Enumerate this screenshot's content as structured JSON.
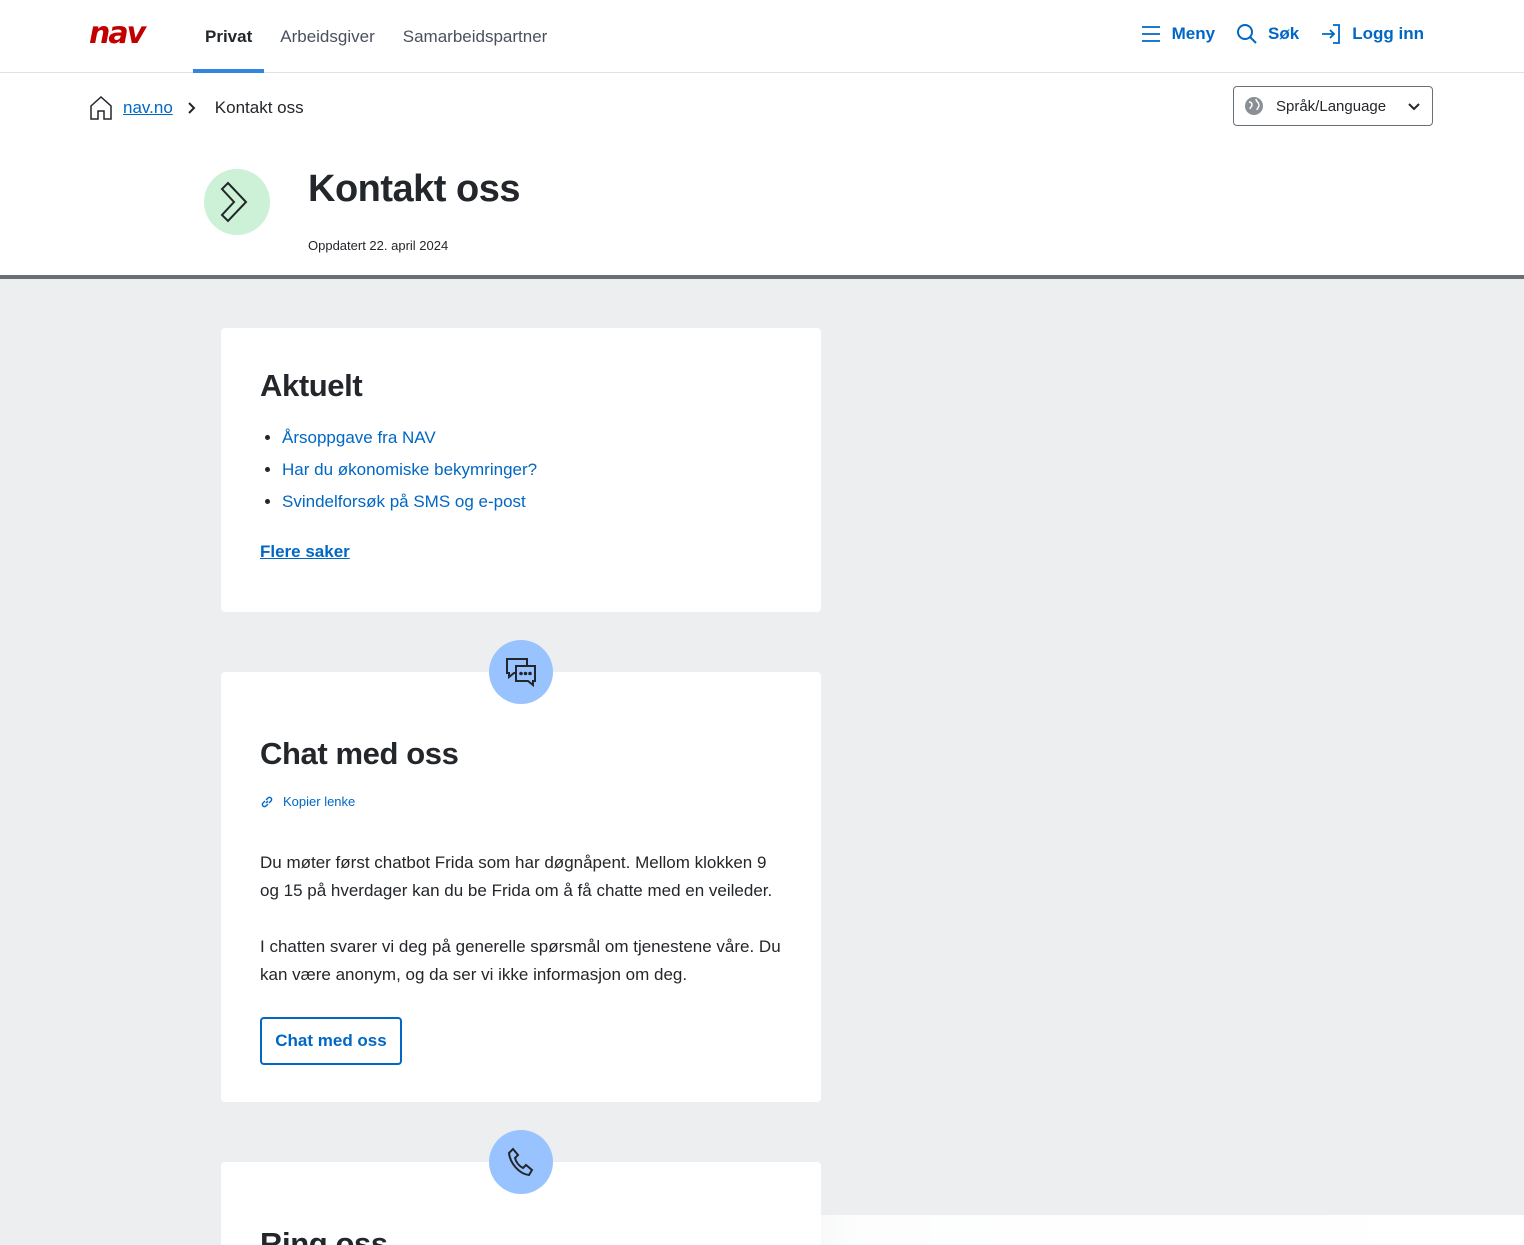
{
  "header": {
    "logo": "nav",
    "tabs": [
      {
        "label": "Privat",
        "active": true
      },
      {
        "label": "Arbeidsgiver",
        "active": false
      },
      {
        "label": "Samarbeidspartner",
        "active": false
      }
    ],
    "menu_label": "Meny",
    "search_label": "Søk",
    "login_label": "Logg inn"
  },
  "breadcrumb": {
    "home": "nav.no",
    "current": "Kontakt oss"
  },
  "language": {
    "label": "Språk/Language"
  },
  "page": {
    "title": "Kontakt oss",
    "updated": "Oppdatert 22. april 2024"
  },
  "aktuelt": {
    "title": "Aktuelt",
    "items": [
      "Årsoppgave fra NAV",
      "Har du økonomiske bekymringer?",
      "Svindelforsøk på SMS og e-post"
    ],
    "more": "Flere saker"
  },
  "chat": {
    "title": "Chat med oss",
    "copy_link": "Kopier lenke",
    "paragraph1": "Du møter først chatbot Frida som har døgnåpent. Mellom klokken 9 og 15 på hverdager kan du be Frida om å få chatte med en veileder.",
    "paragraph2": "I chatten svarer vi deg på generelle spørsmål om tjenestene våre. Du kan være anonym, og da ser vi ikke informasjon om deg.",
    "button": "Chat med oss"
  },
  "ring": {
    "title": "Ring oss"
  },
  "colors": {
    "brand_red": "#c30000",
    "link_blue": "#0067c5",
    "accent_blue": "#3386e0",
    "icon_circle_blue": "#99c3ff",
    "icon_circle_green": "#ccf1d6",
    "gray_bg": "#eceef0"
  }
}
